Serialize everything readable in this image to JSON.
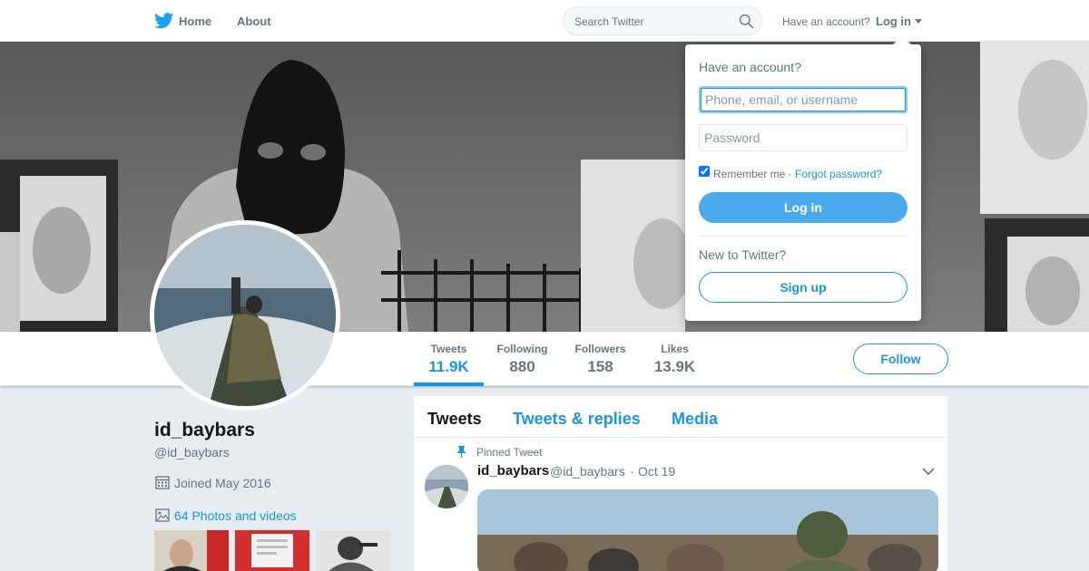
{
  "nav": {
    "home_label": "Home",
    "about_label": "About",
    "search_placeholder": "Search Twitter",
    "have_account": "Have an account?",
    "login_label": "Log in",
    "icons": {
      "logo": "twitter-bird-icon",
      "search": "search-icon",
      "caret": "caret-down-icon"
    }
  },
  "profile": {
    "display_name": "id_baybars",
    "screen_name": "@id_baybars",
    "joined": "Joined May 2016",
    "photos": "64 Photos and videos",
    "follow_label": "Follow",
    "stats": [
      {
        "label": "Tweets",
        "value": "11.9K",
        "active": true
      },
      {
        "label": "Following",
        "value": "880"
      },
      {
        "label": "Followers",
        "value": "158"
      },
      {
        "label": "Likes",
        "value": "13.9K"
      }
    ]
  },
  "timeline": {
    "tabs": [
      "Tweets",
      "Tweets & replies",
      "Media"
    ],
    "active_tab": "Tweets",
    "pinned_label": "Pinned Tweet",
    "tweet": {
      "name": "id_baybars",
      "handle": "@id_baybars",
      "separator": "·",
      "date": "Oct 19"
    }
  },
  "login_dropdown": {
    "title": "Have an account?",
    "username_placeholder": "Phone, email, or username",
    "password_placeholder": "Password",
    "remember_label": "Remember me",
    "remember_checked": true,
    "separator": "·",
    "forgot_label": "Forgot password?",
    "login_button": "Log in",
    "new_label": "New to Twitter?",
    "signup_button": "Sign up"
  },
  "colors": {
    "accent": "#1b95e0",
    "login_button": "#4aaaeb",
    "page_bg": "#e6ecf0",
    "text_secondary": "#657786"
  }
}
